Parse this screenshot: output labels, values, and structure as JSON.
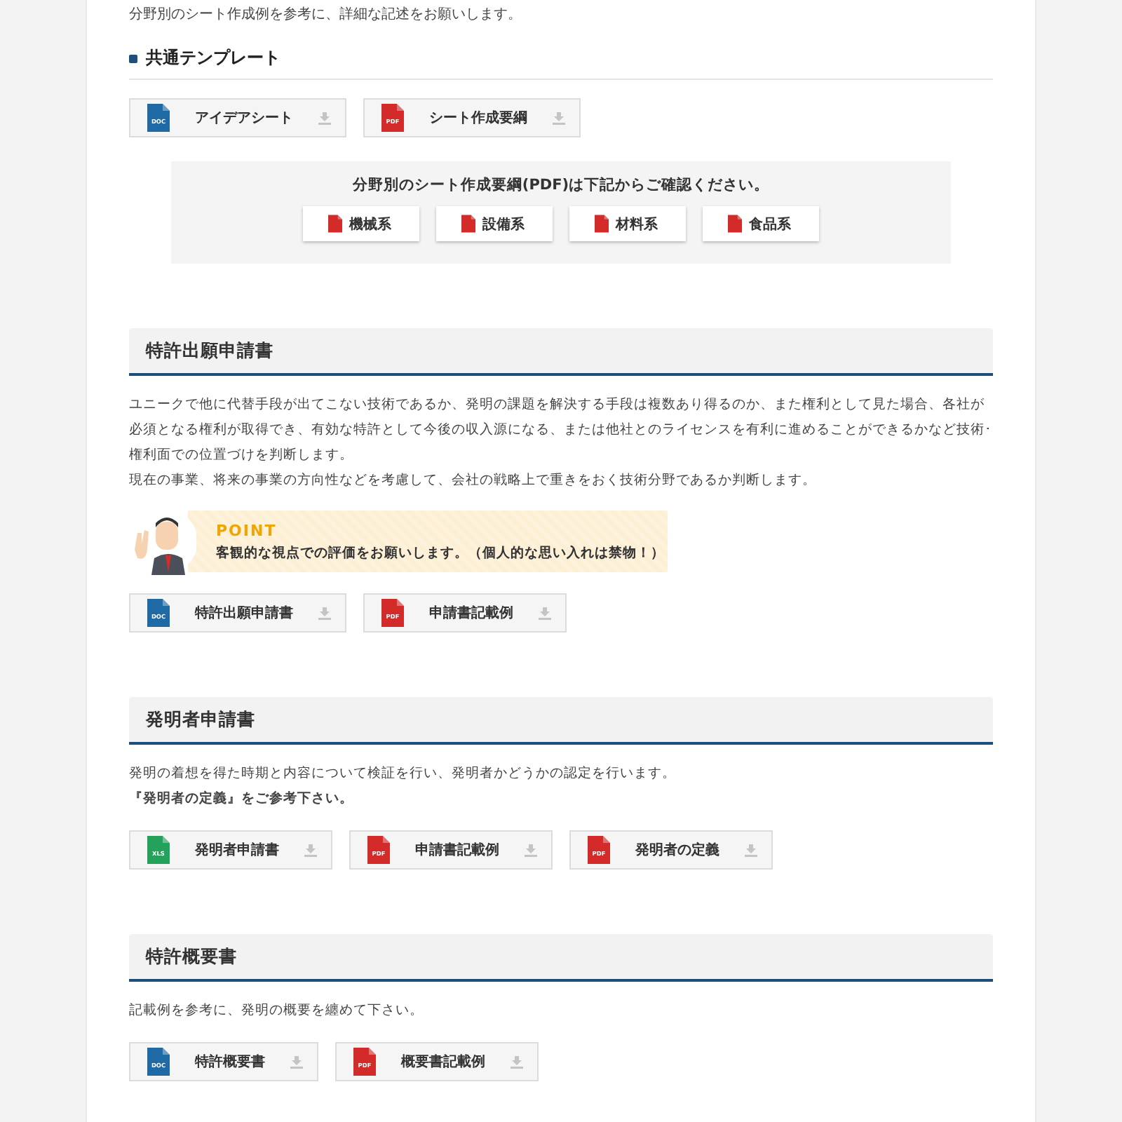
{
  "intro": "分野別のシート作成例を参考に、詳細な記述をお願いします。",
  "common": {
    "heading": "共通テンプレート",
    "files": [
      {
        "kind": "doc",
        "badge": "DOC",
        "label": "アイデアシート"
      },
      {
        "kind": "pdf",
        "badge": "PDF",
        "label": "シート作成要綱"
      }
    ],
    "field_box": {
      "title": "分野別のシート作成要綱(PDF)は下記からご確認ください。",
      "files": [
        {
          "kind": "pdf",
          "label": "機械系"
        },
        {
          "kind": "pdf",
          "label": "設備系"
        },
        {
          "kind": "pdf",
          "label": "材料系"
        },
        {
          "kind": "pdf",
          "label": "食品系"
        }
      ]
    }
  },
  "sections": [
    {
      "heading": "特許出願申請書",
      "paragraphs": [
        {
          "kind": "plain",
          "text": "ユニークで他に代替手段が出てこない技術であるか、発明の課題を解決する手段は複数あり得るのか、また権利として見た場合、各社が必須となる権利が取得でき、有効な特許として今後の収入源になる、または他社とのライセンスを有利に進めることができるかなど技術･権利面での位置づけを判断します。"
        },
        {
          "kind": "plain",
          "text": "現在の事業、将来の事業の方向性などを考慮して、会社の戦略上で重きをおく技術分野であるか判断します。"
        }
      ],
      "point": {
        "title": "POINT",
        "text": "客観的な視点での評価をお願いします。（個人的な思い入れは禁物！）"
      },
      "files": [
        {
          "kind": "doc",
          "badge": "DOC",
          "label": "特許出願申請書"
        },
        {
          "kind": "pdf",
          "badge": "PDF",
          "label": "申請書記載例"
        }
      ]
    },
    {
      "heading": "発明者申請書",
      "paragraphs": [
        {
          "kind": "plain",
          "text": "発明の着想を得た時期と内容について検証を行い、発明者かどうかの認定を行います。"
        },
        {
          "kind": "bold",
          "text": "『発明者の定義』をご参考下さい。"
        }
      ],
      "files": [
        {
          "kind": "xls",
          "badge": "XLS",
          "label": "発明者申請書"
        },
        {
          "kind": "pdf",
          "badge": "PDF",
          "label": "申請書記載例"
        },
        {
          "kind": "pdf",
          "badge": "PDF",
          "label": "発明者の定義"
        }
      ]
    },
    {
      "heading": "特許概要書",
      "paragraphs": [
        {
          "kind": "plain",
          "text": "記載例を参考に、発明の概要を纏めて下さい。"
        }
      ],
      "files": [
        {
          "kind": "doc",
          "badge": "DOC",
          "label": "特許概要書"
        },
        {
          "kind": "pdf",
          "badge": "PDF",
          "label": "概要書記載例"
        }
      ]
    }
  ]
}
